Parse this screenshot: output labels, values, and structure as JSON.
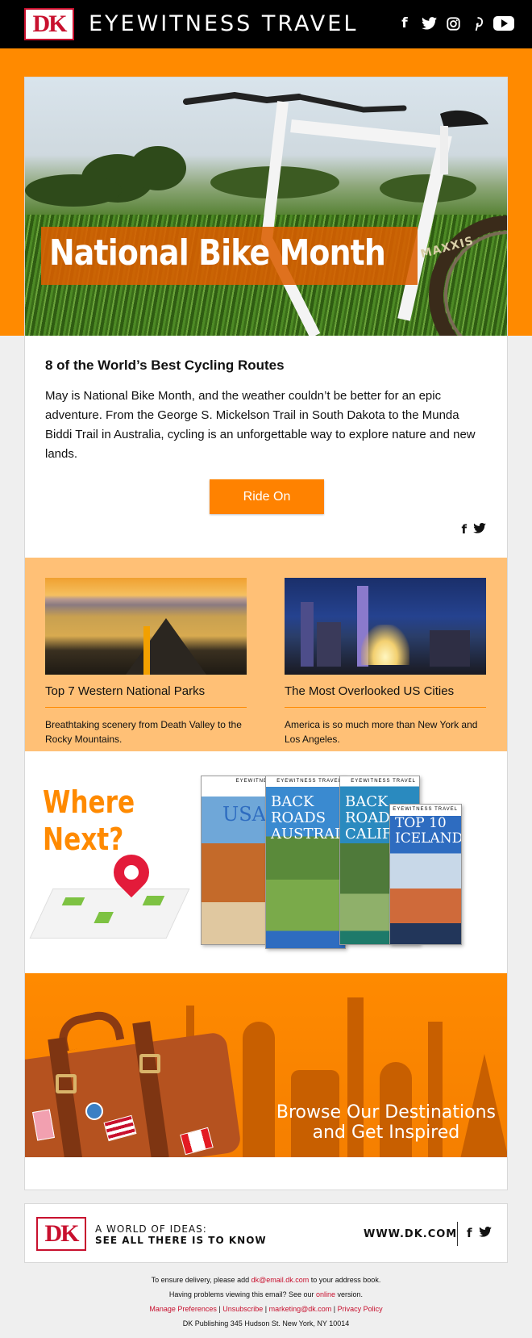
{
  "header": {
    "logo_text": "DK",
    "brand": "EYEWITNESS TRAVEL",
    "social": [
      {
        "icon": "facebook-icon",
        "glyph": "f"
      },
      {
        "icon": "twitter-icon",
        "glyph": "🐦"
      },
      {
        "icon": "instagram-icon",
        "glyph": "◎"
      },
      {
        "icon": "pinterest-icon",
        "glyph": "P"
      },
      {
        "icon": "youtube-icon",
        "glyph": ""
      }
    ]
  },
  "hero": {
    "title": "National Bike Month",
    "tire_text": "MAXXIS"
  },
  "intro": {
    "title": "8 of the World’s Best Cycling Routes",
    "text": "May is National Bike Month, and the weather couldn’t be better for an epic adventure. From the George S. Mickelson Trail in South Dakota to the Munda Biddi Trail in Australia, cycling is an unforgettable way to explore nature and new lands.",
    "cta_label": "Ride On",
    "share": {
      "facebook": "f",
      "twitter": "🐦"
    }
  },
  "features": [
    {
      "title": "Top 7 Western National Parks",
      "text": "Breathtaking scenery from Death Valley to the Rocky Mountains."
    },
    {
      "title": "The Most Overlooked US Cities",
      "text": "America is so much more than New York and Los Angeles."
    }
  ],
  "where_next": {
    "line1": "Where",
    "line2": "Next?",
    "books": [
      {
        "band": "EYEWITNESS",
        "title": "USA"
      },
      {
        "band": "EYEWITNESS TRAVEL",
        "title": "BACK ROADS AUSTRALIA"
      },
      {
        "band": "EYEWITNESS TRAVEL",
        "title": "BACK ROADS CALIFORNIA"
      },
      {
        "band": "EYEWITNESS TRAVEL",
        "title": "TOP 10 ICELAND"
      }
    ]
  },
  "browse": {
    "line1": "Browse Our Destinations",
    "line2": "and Get Inspired"
  },
  "footer": {
    "logo_text": "DK",
    "tagline1": "A WORLD OF IDEAS:",
    "tagline2": "SEE ALL THERE IS TO KNOW",
    "site": "WWW.DK.COM",
    "facebook": "f",
    "twitter": "🐦"
  },
  "legal": {
    "delivery_pre": "To ensure delivery, please add ",
    "delivery_email": "dk@email.dk.com",
    "delivery_post": " to your address book.",
    "problems_pre": "Having problems viewing this email? See our ",
    "problems_link": "online",
    "problems_post": " version.",
    "manage": "Manage Preferences",
    "unsubscribe": "Unsubscribe",
    "marketing": "marketing@dk.com",
    "privacy": "Privacy Policy",
    "sep": " | ",
    "address": "DK Publishing 345 Hudson St. New York, NY 10014"
  },
  "colors": {
    "accent": "#ff8a00",
    "light_accent": "#ffc076",
    "brand_red": "#c8102e"
  }
}
